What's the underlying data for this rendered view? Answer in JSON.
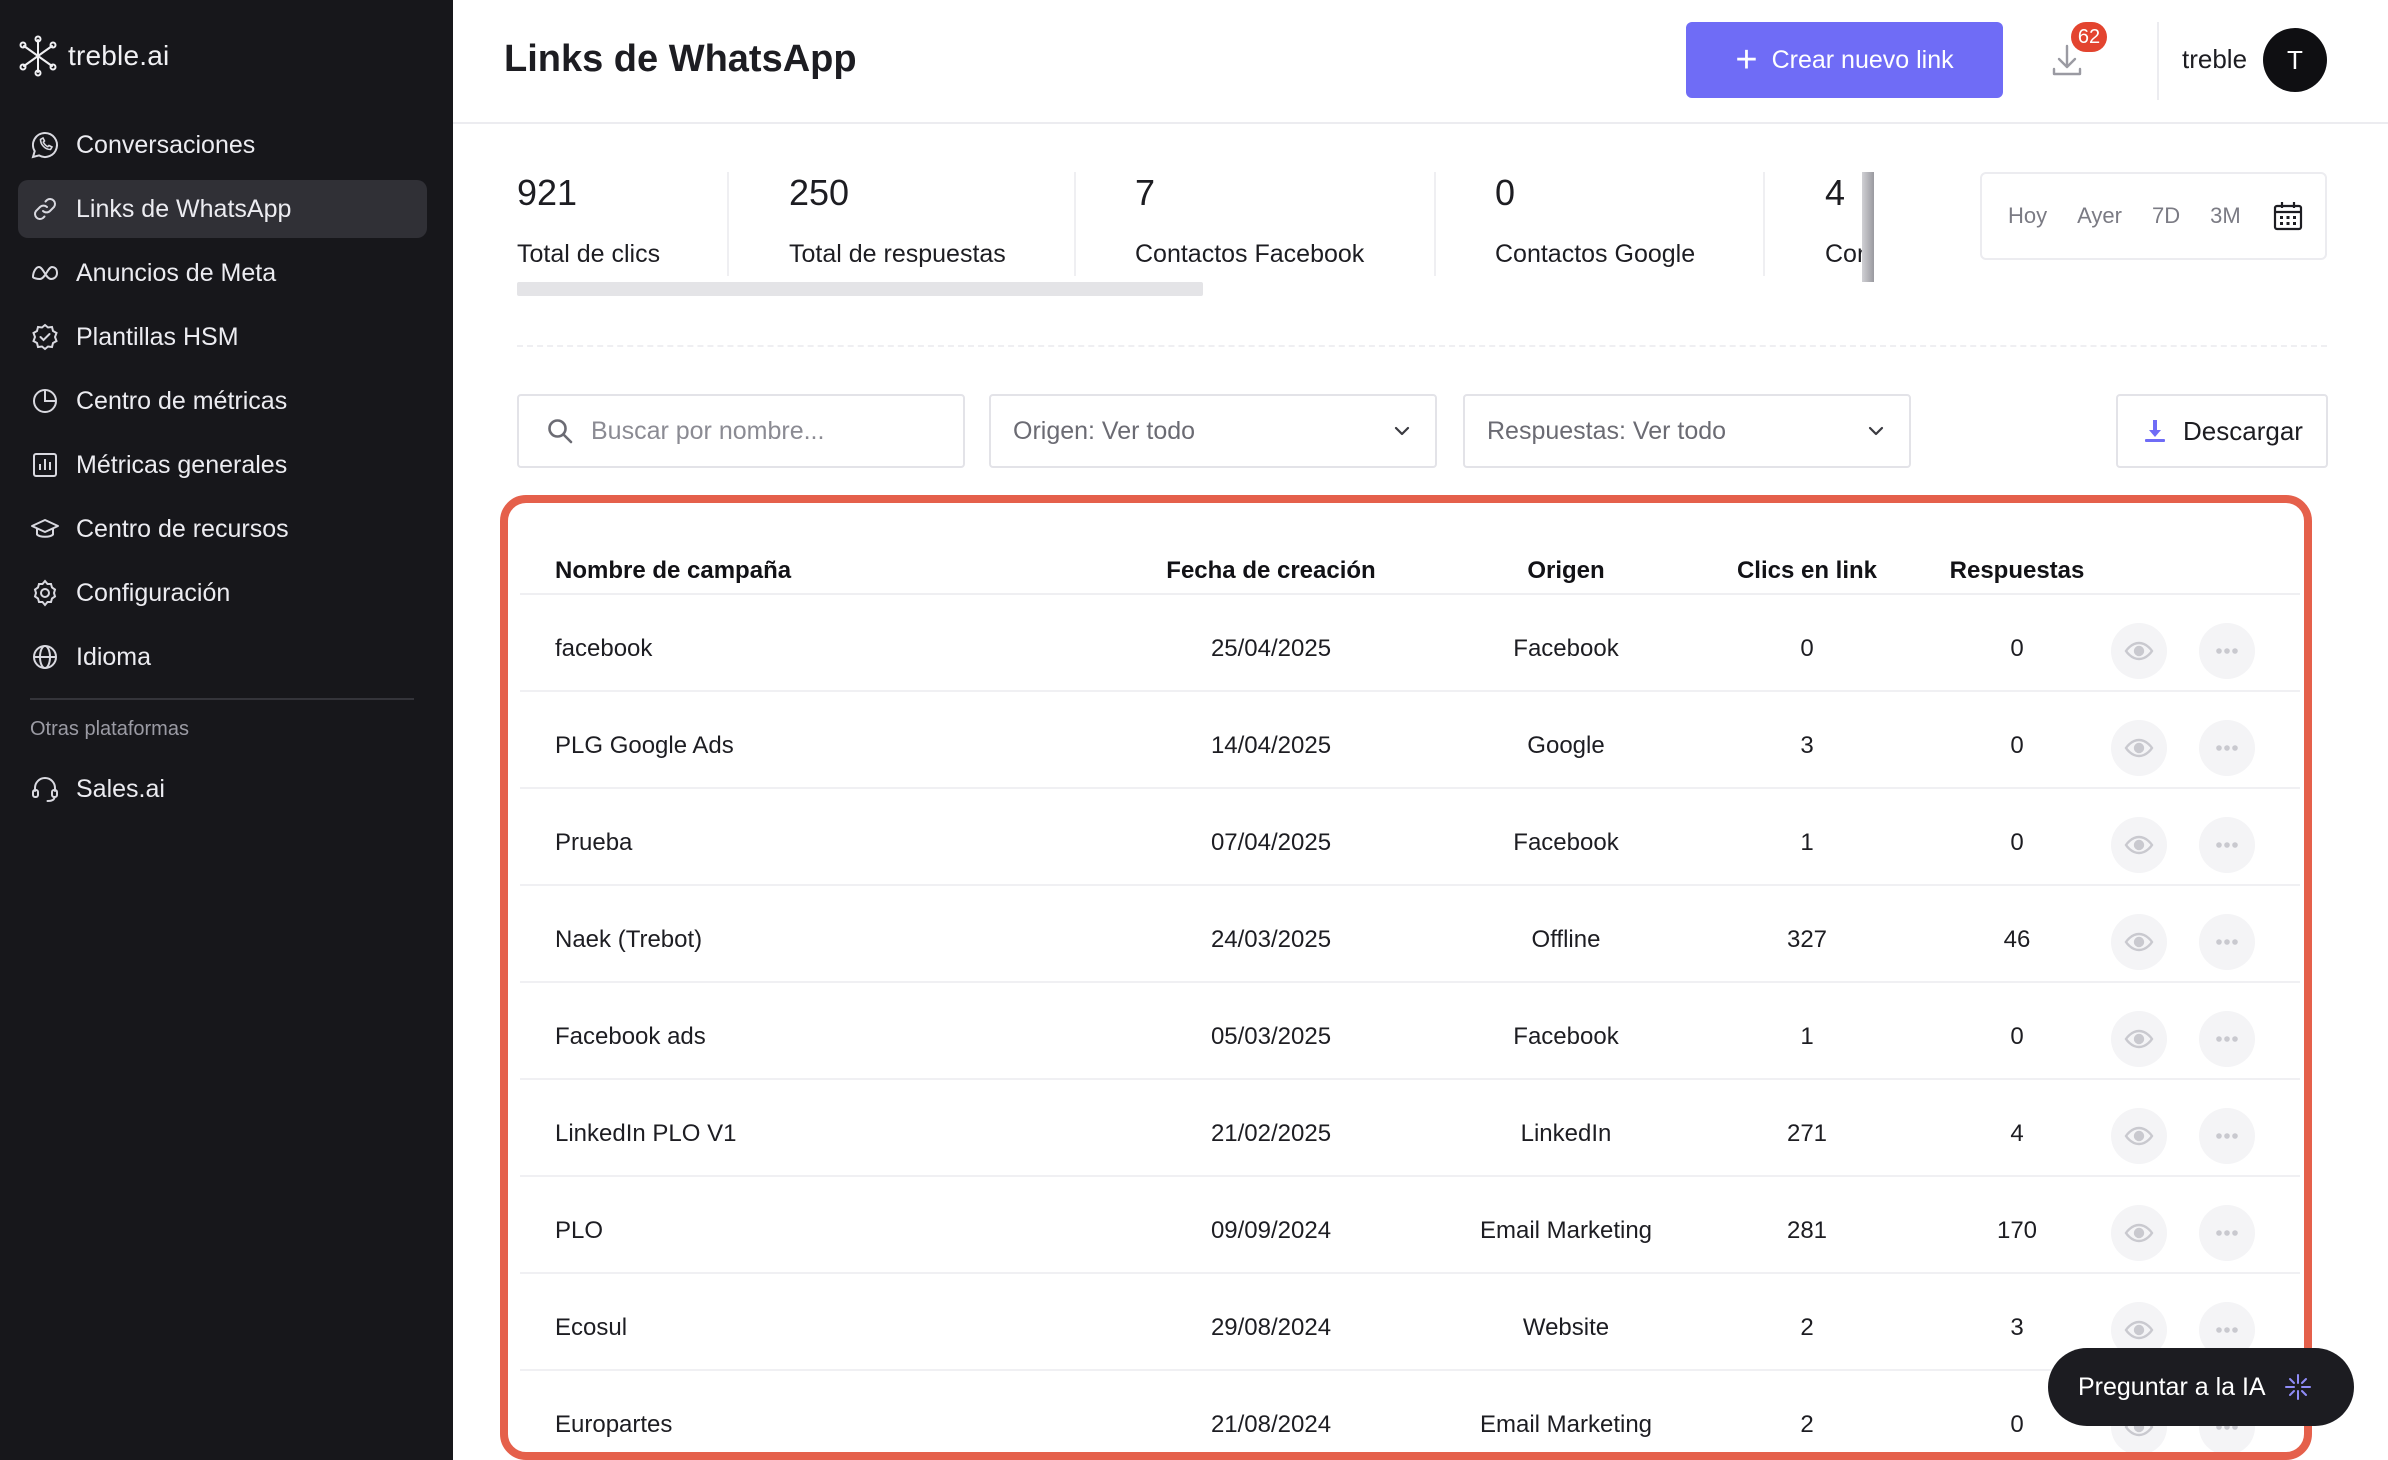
{
  "brand": {
    "name": "treble.ai",
    "icon": "treble-logo-icon"
  },
  "sidebar": {
    "items": [
      {
        "label": "Conversaciones",
        "icon": "whatsapp-icon",
        "active": false
      },
      {
        "label": "Links de WhatsApp",
        "icon": "link-icon",
        "active": true
      },
      {
        "label": "Anuncios de Meta",
        "icon": "meta-icon",
        "active": false
      },
      {
        "label": "Plantillas HSM",
        "icon": "verified-badge-icon",
        "active": false
      },
      {
        "label": "Centro de métricas",
        "icon": "pie-chart-icon",
        "active": false
      },
      {
        "label": "Métricas generales",
        "icon": "bar-chart-icon",
        "active": false
      },
      {
        "label": "Centro de recursos",
        "icon": "graduation-cap-icon",
        "active": false
      },
      {
        "label": "Configuración",
        "icon": "gear-icon",
        "active": false
      },
      {
        "label": "Idioma",
        "icon": "globe-icon",
        "active": false
      }
    ],
    "section_label": "Otras plataformas",
    "other": [
      {
        "label": "Sales.ai",
        "icon": "headset-icon"
      }
    ]
  },
  "header": {
    "title": "Links de WhatsApp",
    "create_label": "Crear nuevo link",
    "notification_count": "62",
    "user_name": "treble",
    "avatar_initial": "T"
  },
  "metrics": [
    {
      "value": "921",
      "label": "Total de clics"
    },
    {
      "value": "250",
      "label": "Total de respuestas"
    },
    {
      "value": "7",
      "label": "Contactos Facebook"
    },
    {
      "value": "0",
      "label": "Contactos Google"
    },
    {
      "value": "4",
      "label": "Con"
    }
  ],
  "date_filter": {
    "options": [
      "Hoy",
      "Ayer",
      "7D",
      "3M"
    ],
    "icon": "calendar-icon"
  },
  "filters": {
    "search_placeholder": "Buscar por nombre...",
    "origin_label": "Origen: Ver todo",
    "responses_label": "Respuestas: Ver todo",
    "download_label": "Descargar"
  },
  "table": {
    "columns": [
      "Nombre de campaña",
      "Fecha de creación",
      "Origen",
      "Clics en link",
      "Respuestas"
    ],
    "rows": [
      {
        "name": "facebook",
        "date": "25/04/2025",
        "origin": "Facebook",
        "clicks": "0",
        "responses": "0"
      },
      {
        "name": "PLG Google Ads",
        "date": "14/04/2025",
        "origin": "Google",
        "clicks": "3",
        "responses": "0"
      },
      {
        "name": "Prueba",
        "date": "07/04/2025",
        "origin": "Facebook",
        "clicks": "1",
        "responses": "0"
      },
      {
        "name": "Naek (Trebot)",
        "date": "24/03/2025",
        "origin": "Offline",
        "clicks": "327",
        "responses": "46"
      },
      {
        "name": "Facebook ads",
        "date": "05/03/2025",
        "origin": "Facebook",
        "clicks": "1",
        "responses": "0"
      },
      {
        "name": "LinkedIn PLO V1",
        "date": "21/02/2025",
        "origin": "LinkedIn",
        "clicks": "271",
        "responses": "4"
      },
      {
        "name": "PLO",
        "date": "09/09/2024",
        "origin": "Email Marketing",
        "clicks": "281",
        "responses": "170"
      },
      {
        "name": "Ecosul",
        "date": "29/08/2024",
        "origin": "Website",
        "clicks": "2",
        "responses": "3"
      },
      {
        "name": "Europartes",
        "date": "21/08/2024",
        "origin": "Email Marketing",
        "clicks": "2",
        "responses": "0"
      }
    ]
  },
  "ask_ai": {
    "label": "Preguntar a la IA",
    "icon": "sparkle-icon"
  },
  "colors": {
    "sidebar_bg": "#17171b",
    "accent": "#6f6cf6",
    "badge": "#e3442f",
    "highlight_outline": "#e5604b"
  }
}
